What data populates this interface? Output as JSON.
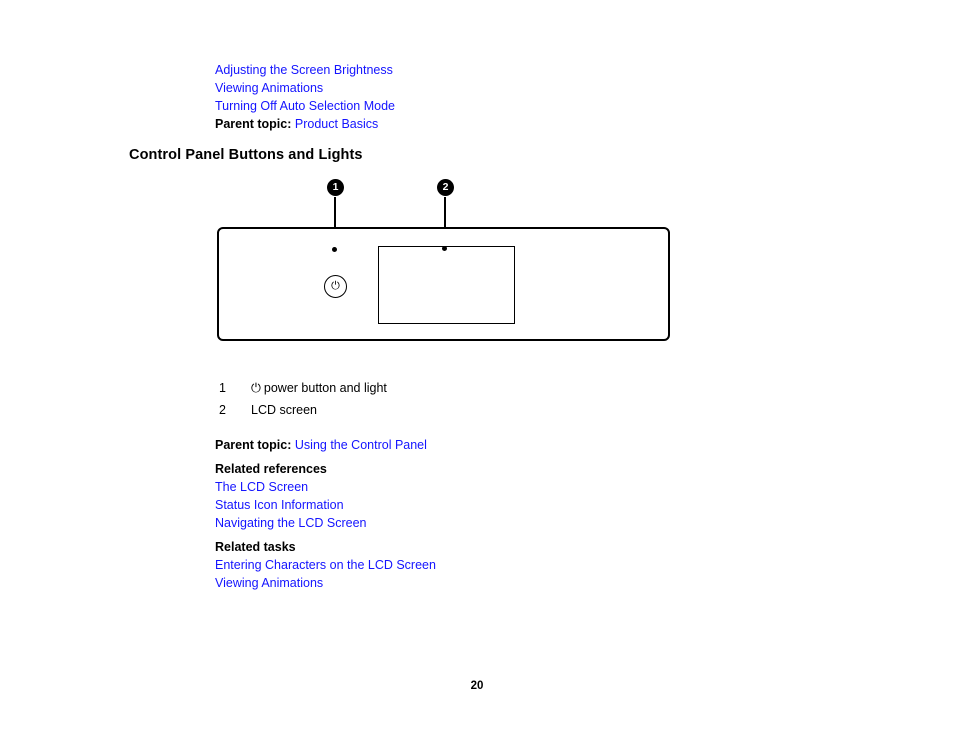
{
  "document": {
    "page_number": "20",
    "link_color": "#1414ff"
  },
  "top_links": {
    "items": [
      "Adjusting the Screen Brightness",
      "Viewing Animations",
      "Turning Off Auto Selection Mode"
    ],
    "parent_topic_label": "Parent topic:",
    "parent_topic_link": "Product Basics"
  },
  "heading": {
    "title": "Control Panel Buttons and Lights"
  },
  "figure": {
    "callouts": [
      {
        "number": "1"
      },
      {
        "number": "2"
      }
    ],
    "power_button_icon": "⏻",
    "power_button_icon_name": "power-icon",
    "lcd_screen_name": "lcd-screen"
  },
  "legend": {
    "rows": [
      {
        "number": "1",
        "icon": "⏻",
        "label": "power button and light"
      },
      {
        "number": "2",
        "icon": "",
        "label": "LCD screen"
      }
    ]
  },
  "bottom": {
    "parent_topic_label": "Parent topic:",
    "parent_topic_link": "Using the Control Panel",
    "related_references_heading": "Related references",
    "related_references": [
      "The LCD Screen",
      "Status Icon Information",
      "Navigating the LCD Screen"
    ],
    "related_tasks_heading": "Related tasks",
    "related_tasks": [
      "Entering Characters on the LCD Screen",
      "Viewing Animations"
    ]
  }
}
